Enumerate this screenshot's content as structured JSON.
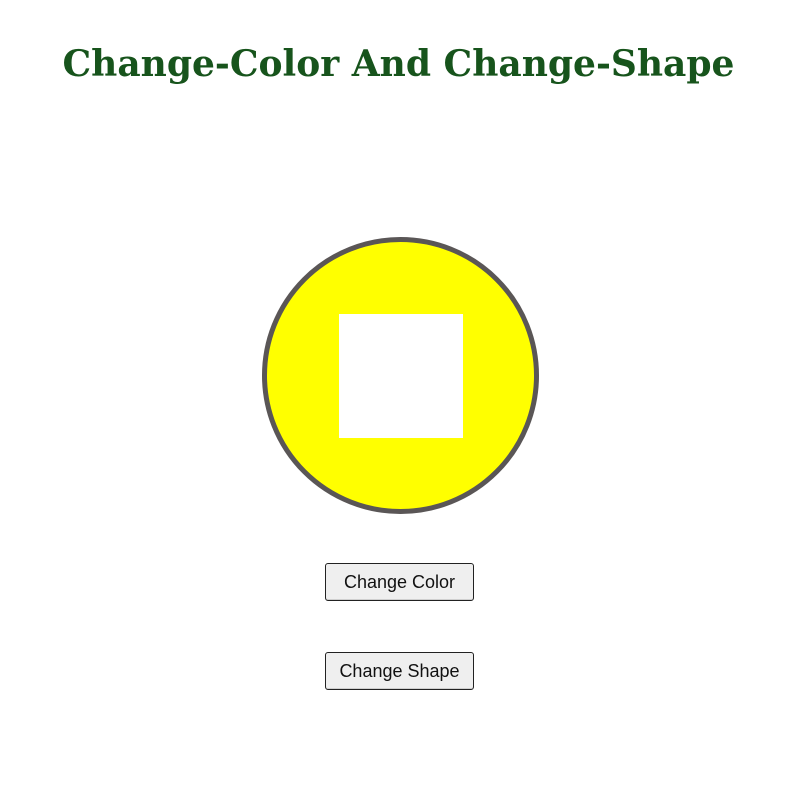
{
  "page": {
    "title": "Change-Color And Change-Shape"
  },
  "shape": {
    "outer": "circle",
    "inner": "square",
    "fill_color": "#ffff00",
    "border_color": "#5a5656",
    "inner_color": "#ffffff"
  },
  "buttons": {
    "change_color_label": "Change Color",
    "change_shape_label": "Change Shape"
  },
  "colors": {
    "title": "#17541c",
    "background": "#ffffff"
  }
}
